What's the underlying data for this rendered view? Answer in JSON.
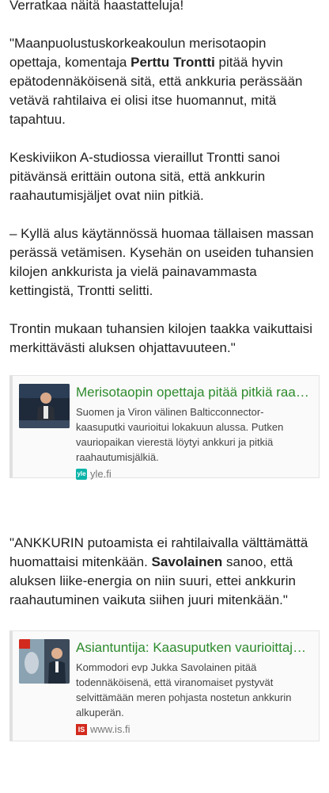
{
  "para1": "Verratkaa näitä haastatteluja!",
  "para2": {
    "before": "\"Maanpuolustuskorkeakoulun merisotaopin opettaja, komentaja ",
    "bold": "Perttu Trontti",
    "after": " pitää hyvin epätodennäköisenä sitä, että ankkuria perässään vetävä rahtilaiva ei olisi itse huomannut, mitä tapahtuu."
  },
  "para3": "Keskiviikon A-studiossa vieraillut Trontti sanoi pitävänsä erittäin outona sitä, että ankkurin raahautumisjäljet ovat niin pitkiä.",
  "para4": "– Kyllä alus käytännössä huomaa tällaisen massan perässä vetämisen. Kysehän on useiden tuhansien kilojen ankkurista ja vielä painavammasta kettingistä, Trontti selitti.",
  "para5": "Trontin mukaan tuhansien kilojen taakka vaikuttaisi merkittävästi aluksen ohjattavuuteen.\"",
  "card1": {
    "title": "Merisotaopin opettaja pitää pitkiä raahautumisjälkiä outoina",
    "desc": "Suomen ja Viron välinen Balticconnector-kaasuputki vaurioitui lokakuun alussa. Putken vauriopaikan vierestä löytyi ankkuri ja pitkiä raahautumisjälkiä.",
    "source": "yle.fi",
    "source_icon": "yle"
  },
  "para6": {
    "before": "\"ANKKURIN putoamista ei rahtilaivalla välttämättä huomattaisi mitenkään. ",
    "bold": "Savolainen",
    "after": " sanoo, että aluksen liike-energia on niin suuri, ettei ankkurin raahautuminen vaikuta siihen juuri mitenkään.\""
  },
  "card2": {
    "title": "Asiantuntija: Kaasuputken vaurioittajan selvittäminen vaikeaa",
    "desc": "Kommodori evp Jukka Savolainen pitää todennäköisenä, että viranomaiset pystyvät selvittämään meren pohjasta nostetun ankkurin alkuperän.",
    "source": "www.is.fi",
    "source_icon": "IS"
  },
  "colors": {
    "link_green": "#2e8b2e",
    "yle_teal": "#0bb3a9",
    "is_red": "#d22a1e"
  }
}
